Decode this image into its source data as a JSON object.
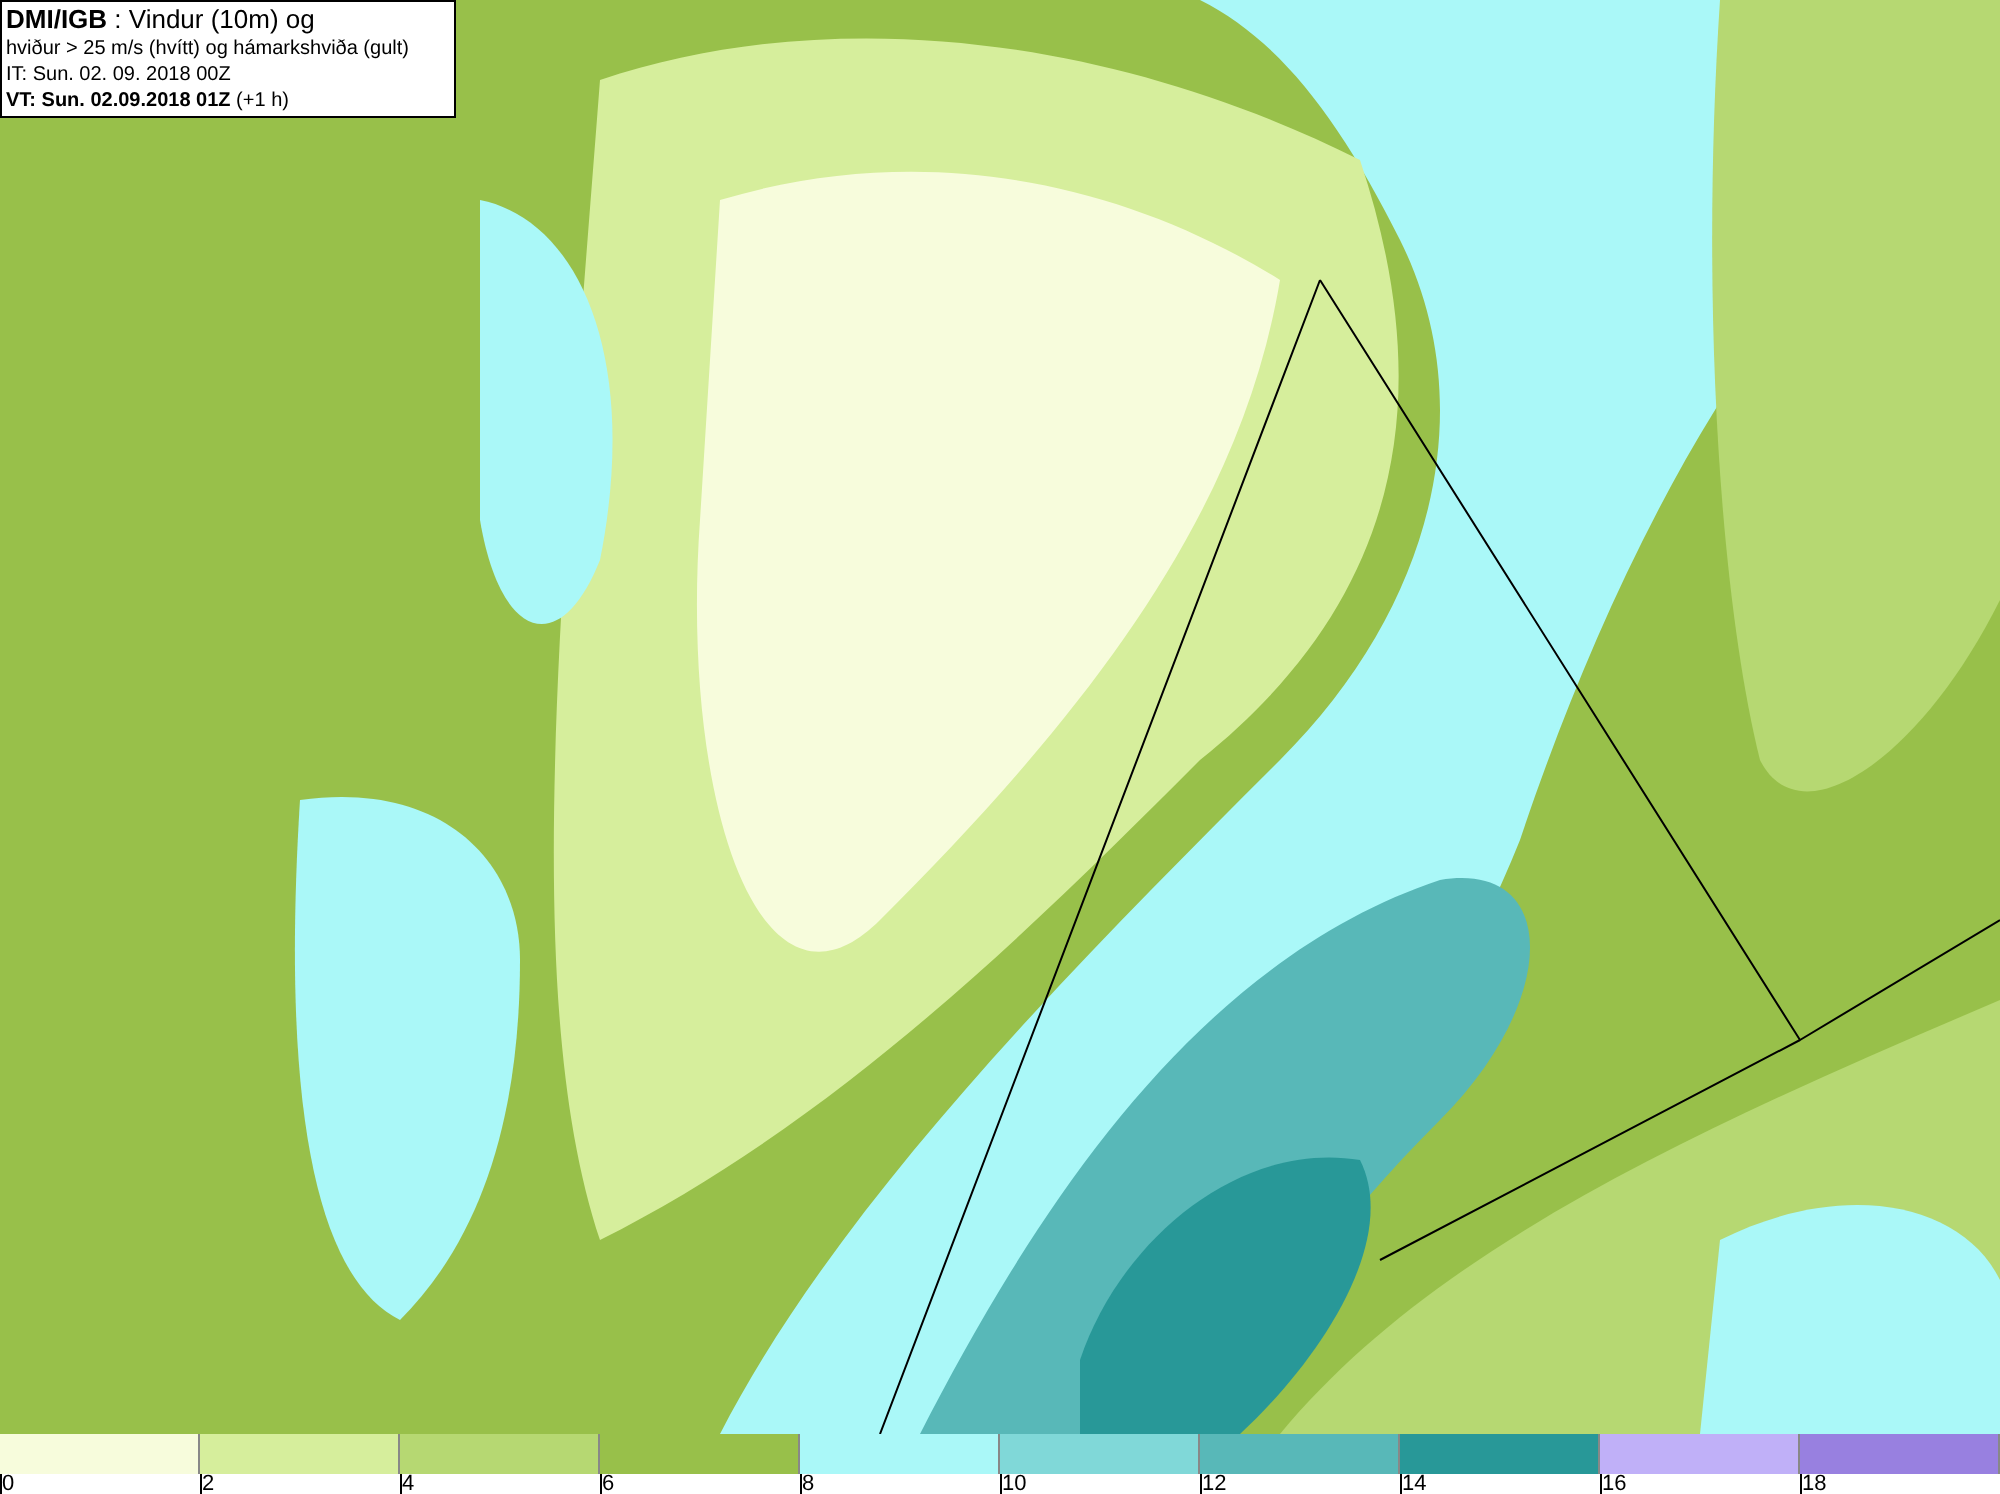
{
  "title_box": {
    "lines": [
      "**DMI/IGB** : Vindur (10m) og",
      "hviður > 25 m/s (hvítt) og hámarkshviða (gult)",
      "IT: Sun. 02. 09. 2018 00Z",
      "**VT: Sun. 02.09.2018 01Z** (+1 h)"
    ]
  },
  "legend": [
    {
      "label": "0",
      "color": "#f7fcdc"
    },
    {
      "label": "2",
      "color": "#d6ee9c"
    },
    {
      "label": "4",
      "color": "#b6d872"
    },
    {
      "label": "6",
      "color": "#98c04a"
    },
    {
      "label": "8",
      "color": "#aaf8f8"
    },
    {
      "label": "10",
      "color": "#80d8d8"
    },
    {
      "label": "12",
      "color": "#58b8b8"
    },
    {
      "label": "14",
      "color": "#289898"
    },
    {
      "label": "16",
      "color": "#c0b0f8"
    },
    {
      "label": "18",
      "color": "#9880e0"
    }
  ]
}
